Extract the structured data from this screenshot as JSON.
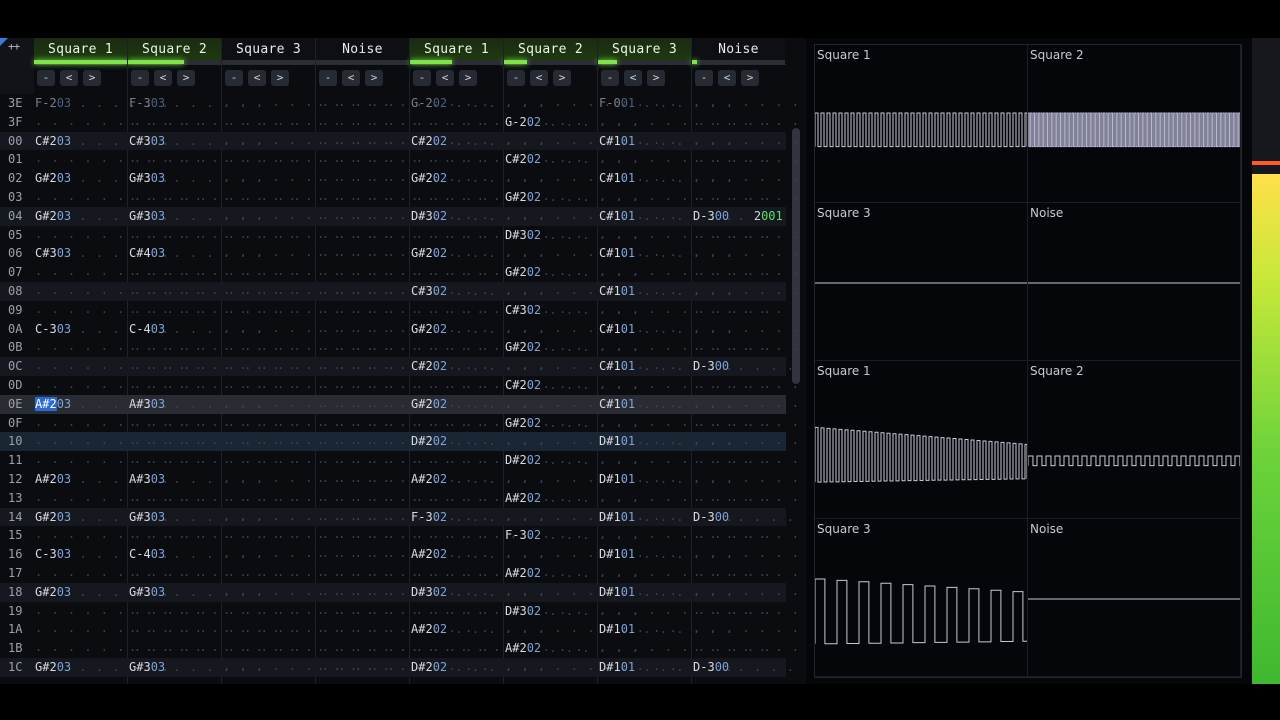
{
  "tracker": {
    "corner_label": "++",
    "channels": [
      {
        "name": "Square 1",
        "active": true,
        "bar": 1.0
      },
      {
        "name": "Square 2",
        "active": true,
        "bar": 0.6
      },
      {
        "name": "Square 3",
        "active": false,
        "bar": 0.0
      },
      {
        "name": "Noise",
        "active": false,
        "bar": 0.0
      },
      {
        "name": "Square 1",
        "active": true,
        "bar": 0.45
      },
      {
        "name": "Square 2",
        "active": true,
        "bar": 0.25
      },
      {
        "name": "Square 3",
        "active": true,
        "bar": 0.2
      },
      {
        "name": "Noise",
        "active": false,
        "bar": 0.05
      }
    ],
    "controls": [
      "-",
      "<",
      ">"
    ],
    "rows": [
      {
        "n": "3E",
        "c": [
          [
            "F-2",
            "03",
            "",
            ""
          ],
          [
            "F-3",
            "03",
            "",
            ""
          ],
          null,
          null,
          [
            "G-2",
            "02",
            "",
            ""
          ],
          null,
          [
            "F-0",
            "01",
            "",
            ""
          ],
          null
        ]
      },
      {
        "n": "3F",
        "c": [
          null,
          null,
          null,
          null,
          null,
          [
            "G-2",
            "02",
            "",
            ""
          ],
          null,
          null
        ]
      },
      {
        "n": "00",
        "c": [
          [
            "C#2",
            "03",
            "",
            ""
          ],
          [
            "C#3",
            "03",
            "",
            ""
          ],
          null,
          null,
          [
            "C#2",
            "02",
            "",
            ""
          ],
          null,
          [
            "C#1",
            "01",
            "",
            ""
          ],
          null
        ]
      },
      {
        "n": "01",
        "c": [
          null,
          null,
          null,
          null,
          null,
          [
            "C#2",
            "02",
            "",
            ""
          ],
          null,
          null
        ]
      },
      {
        "n": "02",
        "c": [
          [
            "G#2",
            "03",
            "",
            ""
          ],
          [
            "G#3",
            "03",
            "",
            ""
          ],
          null,
          null,
          [
            "G#2",
            "02",
            "",
            ""
          ],
          null,
          [
            "C#1",
            "01",
            "",
            ""
          ],
          null
        ]
      },
      {
        "n": "03",
        "c": [
          null,
          null,
          null,
          null,
          null,
          [
            "G#2",
            "02",
            "",
            ""
          ],
          null,
          null
        ]
      },
      {
        "n": "04",
        "c": [
          [
            "G#2",
            "03",
            "",
            ""
          ],
          [
            "G#3",
            "03",
            "",
            ""
          ],
          null,
          null,
          [
            "D#3",
            "02",
            "",
            ""
          ],
          null,
          [
            "C#1",
            "01",
            "",
            ""
          ],
          [
            "D-3",
            "00",
            "2",
            "001"
          ]
        ]
      },
      {
        "n": "05",
        "c": [
          null,
          null,
          null,
          null,
          null,
          [
            "D#3",
            "02",
            "",
            ""
          ],
          null,
          null
        ]
      },
      {
        "n": "06",
        "c": [
          [
            "C#3",
            "03",
            "",
            ""
          ],
          [
            "C#4",
            "03",
            "",
            ""
          ],
          null,
          null,
          [
            "G#2",
            "02",
            "",
            ""
          ],
          null,
          [
            "C#1",
            "01",
            "",
            ""
          ],
          null
        ]
      },
      {
        "n": "07",
        "c": [
          null,
          null,
          null,
          null,
          null,
          [
            "G#2",
            "02",
            "",
            ""
          ],
          null,
          null
        ]
      },
      {
        "n": "08",
        "c": [
          null,
          null,
          null,
          null,
          [
            "C#3",
            "02",
            "",
            ""
          ],
          null,
          [
            "C#1",
            "01",
            "",
            ""
          ],
          null
        ]
      },
      {
        "n": "09",
        "c": [
          null,
          null,
          null,
          null,
          null,
          [
            "C#3",
            "02",
            "",
            ""
          ],
          null,
          null
        ]
      },
      {
        "n": "0A",
        "c": [
          [
            "C-3",
            "03",
            "",
            ""
          ],
          [
            "C-4",
            "03",
            "",
            ""
          ],
          null,
          null,
          [
            "G#2",
            "02",
            "",
            ""
          ],
          null,
          [
            "C#1",
            "01",
            "",
            ""
          ],
          null
        ]
      },
      {
        "n": "0B",
        "c": [
          null,
          null,
          null,
          null,
          null,
          [
            "G#2",
            "02",
            "",
            ""
          ],
          null,
          null
        ]
      },
      {
        "n": "0C",
        "c": [
          null,
          null,
          null,
          null,
          [
            "C#2",
            "02",
            "",
            ""
          ],
          null,
          [
            "C#1",
            "01",
            "",
            ""
          ],
          [
            "D-3",
            "00",
            "",
            ""
          ]
        ]
      },
      {
        "n": "0D",
        "c": [
          null,
          null,
          null,
          null,
          null,
          [
            "C#2",
            "02",
            "",
            ""
          ],
          null,
          null
        ]
      },
      {
        "n": "0E",
        "c": [
          [
            "A#2",
            "03",
            "",
            ""
          ],
          [
            "A#3",
            "03",
            "",
            ""
          ],
          null,
          null,
          [
            "G#2",
            "02",
            "",
            ""
          ],
          null,
          [
            "C#1",
            "01",
            "",
            ""
          ],
          null
        ]
      },
      {
        "n": "0F",
        "c": [
          null,
          null,
          null,
          null,
          null,
          [
            "G#2",
            "02",
            "",
            ""
          ],
          null,
          null
        ]
      },
      {
        "n": "10",
        "c": [
          null,
          null,
          null,
          null,
          [
            "D#2",
            "02",
            "",
            ""
          ],
          null,
          [
            "D#1",
            "01",
            "",
            ""
          ],
          null
        ]
      },
      {
        "n": "11",
        "c": [
          null,
          null,
          null,
          null,
          null,
          [
            "D#2",
            "02",
            "",
            ""
          ],
          null,
          null
        ]
      },
      {
        "n": "12",
        "c": [
          [
            "A#2",
            "03",
            "",
            ""
          ],
          [
            "A#3",
            "03",
            "",
            ""
          ],
          null,
          null,
          [
            "A#2",
            "02",
            "",
            ""
          ],
          null,
          [
            "D#1",
            "01",
            "",
            ""
          ],
          null
        ]
      },
      {
        "n": "13",
        "c": [
          null,
          null,
          null,
          null,
          null,
          [
            "A#2",
            "02",
            "",
            ""
          ],
          null,
          null
        ]
      },
      {
        "n": "14",
        "c": [
          [
            "G#2",
            "03",
            "",
            ""
          ],
          [
            "G#3",
            "03",
            "",
            ""
          ],
          null,
          null,
          [
            "F-3",
            "02",
            "",
            ""
          ],
          null,
          [
            "D#1",
            "01",
            "",
            ""
          ],
          [
            "D-3",
            "00",
            "",
            ""
          ]
        ]
      },
      {
        "n": "15",
        "c": [
          null,
          null,
          null,
          null,
          null,
          [
            "F-3",
            "02",
            "",
            ""
          ],
          null,
          null
        ]
      },
      {
        "n": "16",
        "c": [
          [
            "C-3",
            "03",
            "",
            ""
          ],
          [
            "C-4",
            "03",
            "",
            ""
          ],
          null,
          null,
          [
            "A#2",
            "02",
            "",
            ""
          ],
          null,
          [
            "D#1",
            "01",
            "",
            ""
          ],
          null
        ]
      },
      {
        "n": "17",
        "c": [
          null,
          null,
          null,
          null,
          null,
          [
            "A#2",
            "02",
            "",
            ""
          ],
          null,
          null
        ]
      },
      {
        "n": "18",
        "c": [
          [
            "G#2",
            "03",
            "",
            ""
          ],
          [
            "G#3",
            "03",
            "",
            ""
          ],
          null,
          null,
          [
            "D#3",
            "02",
            "",
            ""
          ],
          null,
          [
            "D#1",
            "01",
            "",
            ""
          ],
          null
        ]
      },
      {
        "n": "19",
        "c": [
          null,
          null,
          null,
          null,
          null,
          [
            "D#3",
            "02",
            "",
            ""
          ],
          null,
          null
        ]
      },
      {
        "n": "1A",
        "c": [
          null,
          null,
          null,
          null,
          [
            "A#2",
            "02",
            "",
            ""
          ],
          null,
          [
            "D#1",
            "01",
            "",
            ""
          ],
          null
        ]
      },
      {
        "n": "1B",
        "c": [
          null,
          null,
          null,
          null,
          null,
          [
            "A#2",
            "02",
            "",
            ""
          ],
          null,
          null
        ]
      },
      {
        "n": "1C",
        "c": [
          [
            "G#2",
            "03",
            "",
            ""
          ],
          [
            "G#3",
            "03",
            "",
            ""
          ],
          null,
          null,
          [
            "D#2",
            "02",
            "",
            ""
          ],
          null,
          [
            "D#1",
            "01",
            "",
            ""
          ],
          [
            "D-3",
            "00",
            "",
            ""
          ]
        ]
      }
    ]
  },
  "scope": {
    "cells": [
      {
        "label": "Square 1",
        "wave": "dense-square"
      },
      {
        "label": "Square 2",
        "wave": "very-dense"
      },
      {
        "label": "Square 3",
        "wave": "flat"
      },
      {
        "label": "Noise",
        "wave": "flat"
      },
      {
        "label": "Square 1",
        "wave": "decay-square"
      },
      {
        "label": "Square 2",
        "wave": "small-square"
      },
      {
        "label": "Square 3",
        "wave": "large-square"
      },
      {
        "label": "Noise",
        "wave": "flat"
      }
    ]
  },
  "meter": {
    "level": 0.79,
    "peak": 0.8
  },
  "colors": {
    "accent": "#7fe34a",
    "cursor": "#2a6ad4",
    "effect_value": "#5be06a"
  }
}
